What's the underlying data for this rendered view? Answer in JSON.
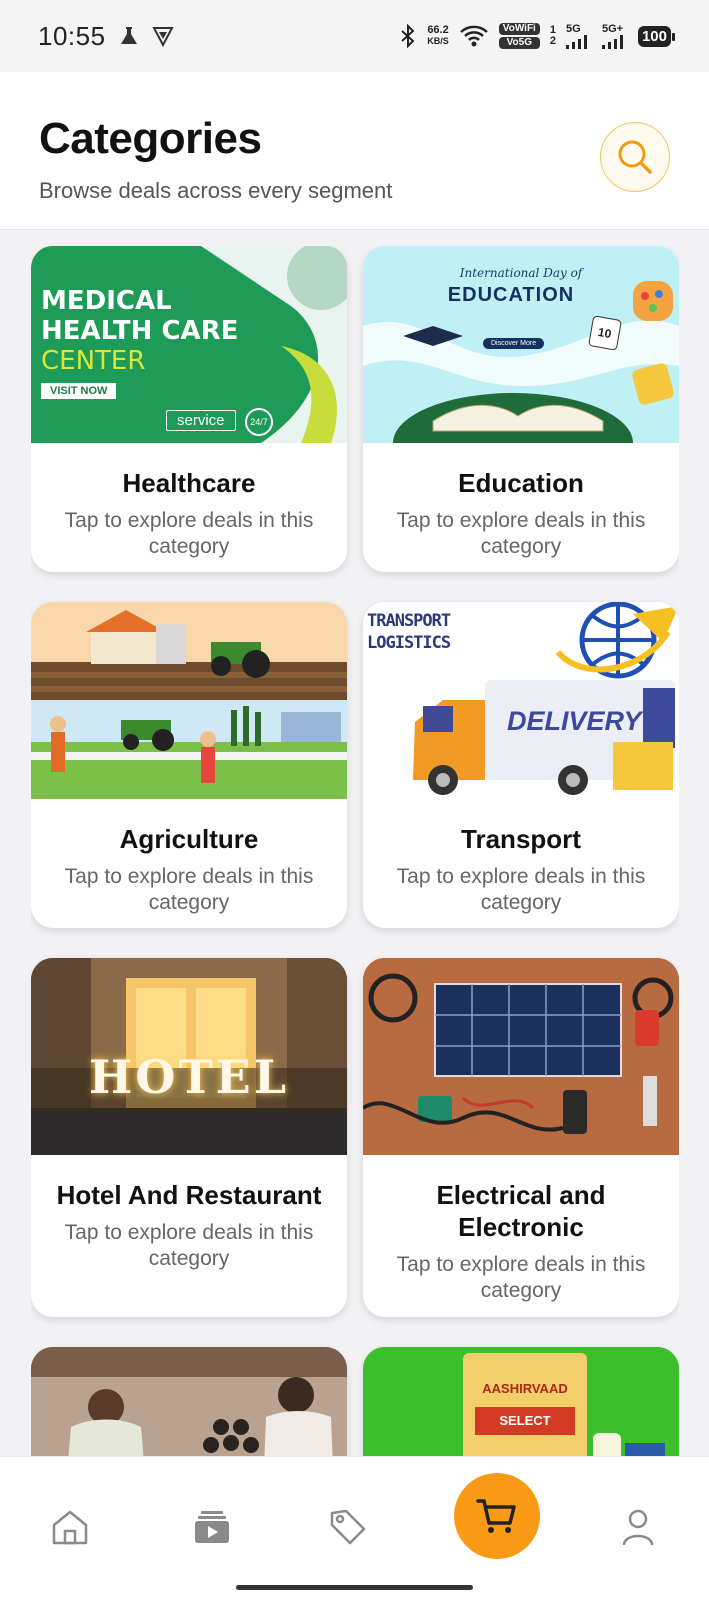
{
  "status_bar": {
    "time": "10:55",
    "net_speed_value": "66.2",
    "net_speed_unit": "KB/S",
    "vowifi": "VoWiFi",
    "vo5g": "Vo5G",
    "sim1": "1",
    "sim2": "2",
    "net1": "5G",
    "net2": "5G+",
    "battery": "100"
  },
  "header": {
    "title": "Categories",
    "subtitle": "Browse deals across every segment"
  },
  "categories": [
    {
      "name": "Healthcare",
      "subtitle": "Tap to explore deals in this category",
      "banner": {
        "line1": "MEDICAL",
        "line2": "HEALTH CARE",
        "line3": "CENTER",
        "cta": "VISIT NOW",
        "service": "service",
        "badge": "24/7"
      }
    },
    {
      "name": "Education",
      "subtitle": "Tap to explore deals in this category",
      "banner": {
        "line1": "International Day of",
        "line2": "EDUCATION",
        "cta": "Discover More",
        "number": "10"
      }
    },
    {
      "name": "Agriculture",
      "subtitle": "Tap to explore deals in this category"
    },
    {
      "name": "Transport",
      "subtitle": "Tap to explore deals in this category",
      "banner": {
        "line1": "TRANSPORT",
        "line2": "LOGISTICS",
        "truck_text": "DELIVERY"
      }
    },
    {
      "name": "Hotel And Restaurant",
      "subtitle": "Tap to explore deals in this category",
      "banner": {
        "sign": "HOTEL"
      }
    },
    {
      "name": "Electrical and Electronic",
      "subtitle": "Tap to explore deals in this category"
    },
    {
      "name": "",
      "subtitle": ""
    },
    {
      "name": "",
      "subtitle": "",
      "banner": {
        "brand": "AASHIRVAAD",
        "variant": "SELECT"
      }
    }
  ],
  "colors": {
    "accent": "#fb9a14",
    "search_ring": "#f5c45a",
    "healthcare_green": "#1e9b57",
    "education_cyan": "#bff0f5"
  },
  "bottom_nav": [
    "home-icon",
    "video-icon",
    "tag-icon",
    "cart-icon",
    "profile-icon"
  ]
}
